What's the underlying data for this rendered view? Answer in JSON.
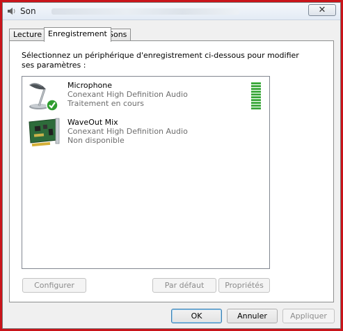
{
  "window": {
    "title": "Son",
    "close_symbol": "✕",
    "colors": {
      "accent": "#3c7fb1",
      "meter": "#3aa33a",
      "desktop": "#c9141a"
    }
  },
  "tabs": [
    {
      "label": "Lecture",
      "active": false
    },
    {
      "label": "Enregistrement",
      "active": true
    },
    {
      "label": "Sons",
      "active": false
    }
  ],
  "panel": {
    "instructions": "Sélectionnez un périphérique d'enregistrement ci-dessous pour modifier ses paramètres :"
  },
  "devices": [
    {
      "name": "Microphone",
      "driver": "Conexant High Definition Audio",
      "status": "Traitement en cours",
      "icon": "microphone-icon",
      "default": true,
      "level_bars": 10
    },
    {
      "name": "WaveOut Mix",
      "driver": "Conexant High Definition Audio",
      "status": "Non disponible",
      "icon": "sound-card-icon",
      "default": false
    }
  ],
  "buttons": {
    "configure": "Configurer",
    "set_default": "Par défaut",
    "properties": "Propriétés",
    "ok": "OK",
    "cancel": "Annuler",
    "apply": "Appliquer"
  }
}
